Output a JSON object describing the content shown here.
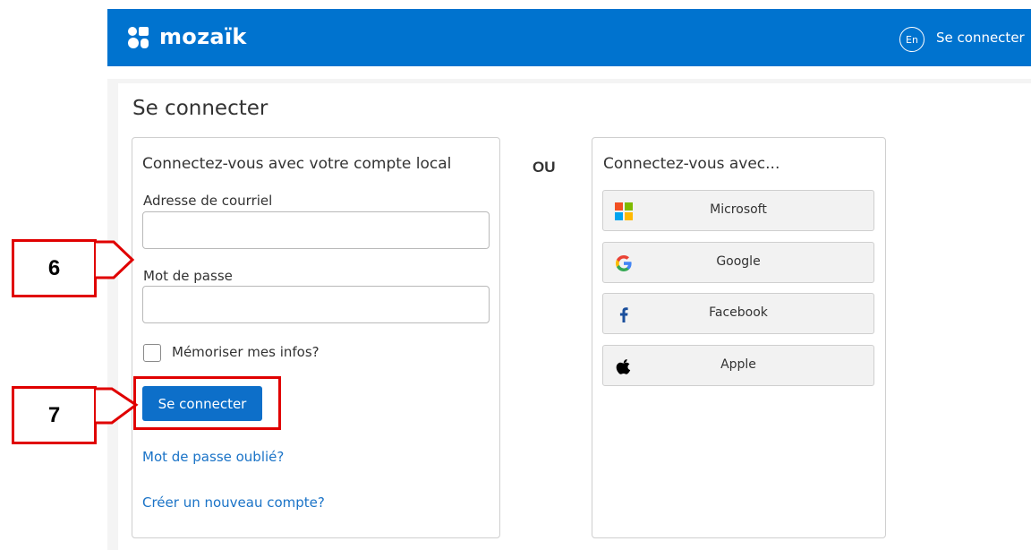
{
  "header": {
    "brand": "mozaïk",
    "language_toggle": "En",
    "signin_link": "Se connecter",
    "color": "#0073cf"
  },
  "page": {
    "title": "Se connecter"
  },
  "local_account": {
    "heading": "Connectez-vous avec votre compte local",
    "email_label": "Adresse de courriel",
    "email_value": "",
    "password_label": "Mot de passe",
    "password_value": "",
    "remember_label": "Mémoriser mes infos?",
    "remember_checked": false,
    "submit_label": "Se connecter",
    "forgot_password_link": "Mot de passe oublié?",
    "create_account_link": "Créer un nouveau compte?"
  },
  "separator": "OU",
  "social": {
    "heading": "Connectez-vous avec...",
    "providers": [
      {
        "label": "Microsoft",
        "icon": "microsoft-icon"
      },
      {
        "label": "Google",
        "icon": "google-icon"
      },
      {
        "label": "Facebook",
        "icon": "facebook-icon"
      },
      {
        "label": "Apple",
        "icon": "apple-icon"
      }
    ]
  },
  "annotations": {
    "step_6": "6",
    "step_7": "7",
    "color": "#e00000"
  }
}
